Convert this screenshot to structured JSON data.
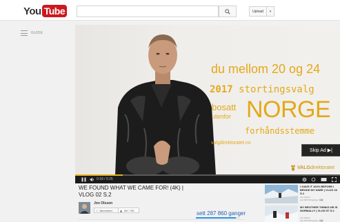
{
  "header": {
    "logo_you": "You",
    "logo_tube": "Tube",
    "search_placeholder": "",
    "upload_label": "Upload",
    "upload_caret": "▾"
  },
  "sidebar": {
    "guide_label": "GUIDE"
  },
  "ad": {
    "line1": "du mellom 20 og 24",
    "year": "2017",
    "line2_rest": " stortingsvalg",
    "bosatt": "bosatt",
    "utenfor": "utenfor",
    "norge": "NORGE",
    "forhandsstemme": "forhåndsstemme",
    "url": "valgdirektoratet.no",
    "skip_label": "Skip Ad ▶|",
    "brand_bold": "VALG",
    "brand_light": "direktoratet",
    "progress_fraction": 0.18,
    "accent_color": "#e3a81a"
  },
  "player": {
    "time": "0:18 / 0:25"
  },
  "video": {
    "title": "WE FOUND WHAT WE CAME FOR! (4K) | VLOG 02 S.2",
    "channel_name": "Jon Olsson",
    "subscribe_label": "Abonnerer",
    "subscriber_count": "687 785",
    "views": "sett 287 860 ganger",
    "like_fraction": 0.92
  },
  "related": [
    {
      "title": "I GAVE IT 100% BEFORE I BROKE MY KNEE | VLOG 26 S.2",
      "channel": "Jon Olsson",
      "meta": "sett 390 000 ganger",
      "badge": "HD"
    },
    {
      "title": "MY BROTHER THINKS HE IS NORMALLY | VLOG 57 S.2",
      "channel": "Jon Olsson",
      "meta": "sett 400 000 ganger",
      "badge": "HD"
    }
  ]
}
